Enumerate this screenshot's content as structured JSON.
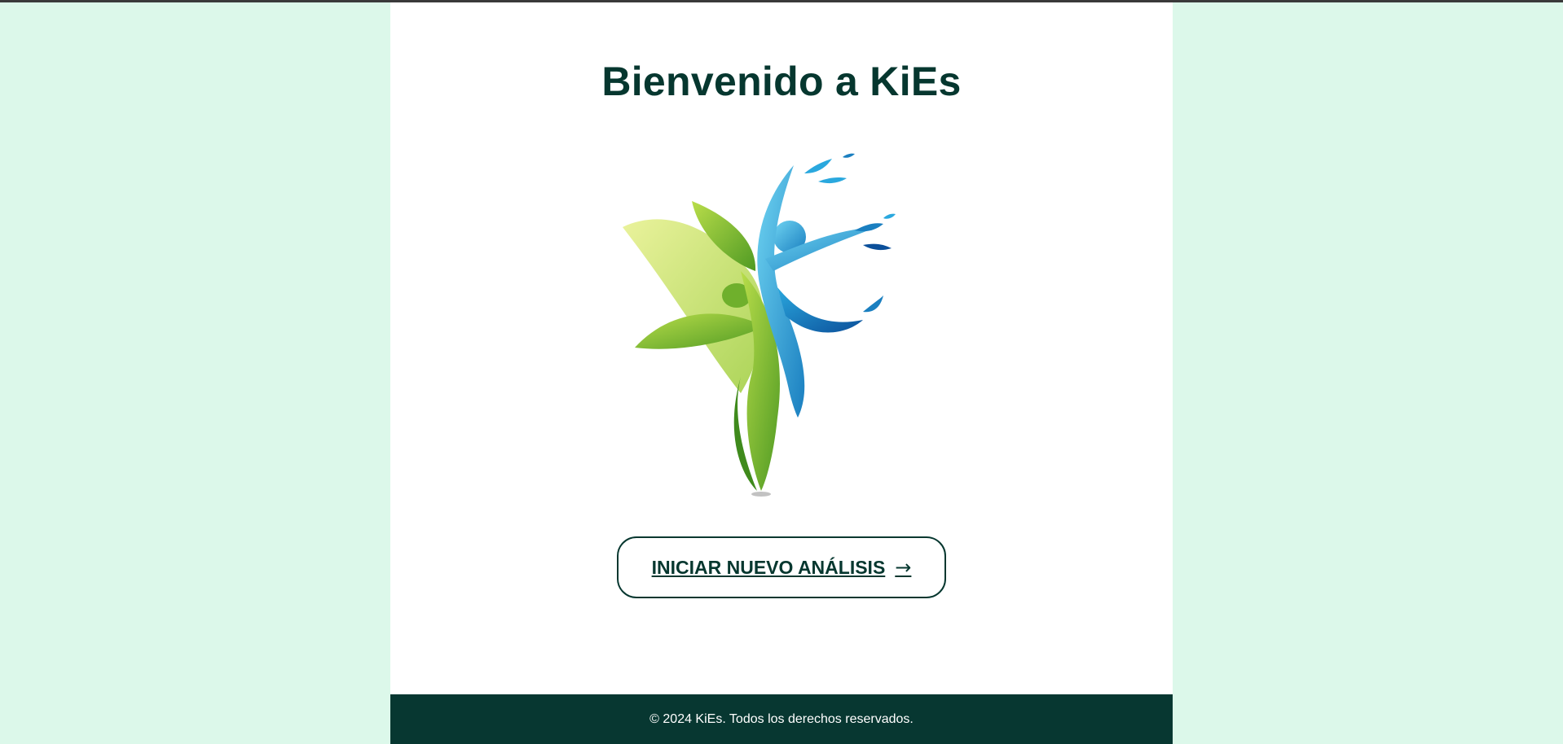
{
  "page": {
    "title": "Bienvenido a KiEs"
  },
  "logo": {
    "icon": "kies-leaf-figure-logo",
    "alt": "KiEs"
  },
  "cta": {
    "label": "INICIAR NUEVO ANÁLISIS",
    "arrow": "→"
  },
  "footer": {
    "text": "© 2024 KiEs. Todos los derechos reservados."
  },
  "colors": {
    "background": "#dcf8ea",
    "card": "#ffffff",
    "primary": "#06372f",
    "footer": "#073731",
    "leaf_green": "#8cc63f",
    "water_blue": "#29a9dc"
  }
}
